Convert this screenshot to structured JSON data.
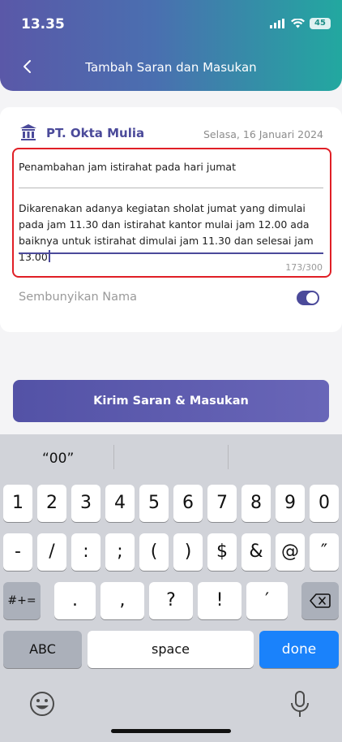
{
  "status_bar": {
    "time": "13.35",
    "battery": "45"
  },
  "header": {
    "title": "Tambah Saran dan Masukan"
  },
  "card": {
    "company_name": "PT. Okta Mulia",
    "date": "Selasa, 16 Januari 2024",
    "subject_value": "Penambahan jam istirahat pada hari jumat",
    "body_value": "Dikarenakan adanya kegiatan sholat jumat yang dimulai pada jam 11.30 dan istirahat kantor mulai jam 12.00 ada baiknya untuk istirahat dimulai jam 11.30 dan selesai jam 13.00",
    "counter": "173/300",
    "hide_name_label": "Sembunyikan Nama",
    "hide_name_on": true
  },
  "submit_label": "Kirim Saran & Masukan",
  "keyboard": {
    "suggestions": [
      "“00”",
      "",
      ""
    ],
    "row1": [
      "1",
      "2",
      "3",
      "4",
      "5",
      "6",
      "7",
      "8",
      "9",
      "0"
    ],
    "row2": [
      "-",
      "/",
      ":",
      ";",
      "(",
      ")",
      "$",
      "&",
      "@",
      "″"
    ],
    "row3": [
      ".",
      ",",
      "?",
      "!",
      "′"
    ],
    "symbols_key": "#+=",
    "abc_key": "ABC",
    "space_key": "space",
    "done_key": "done"
  },
  "colors": {
    "accent": "#4b4a9a",
    "error_border": "#e01f26",
    "done_key": "#1a82fb"
  }
}
